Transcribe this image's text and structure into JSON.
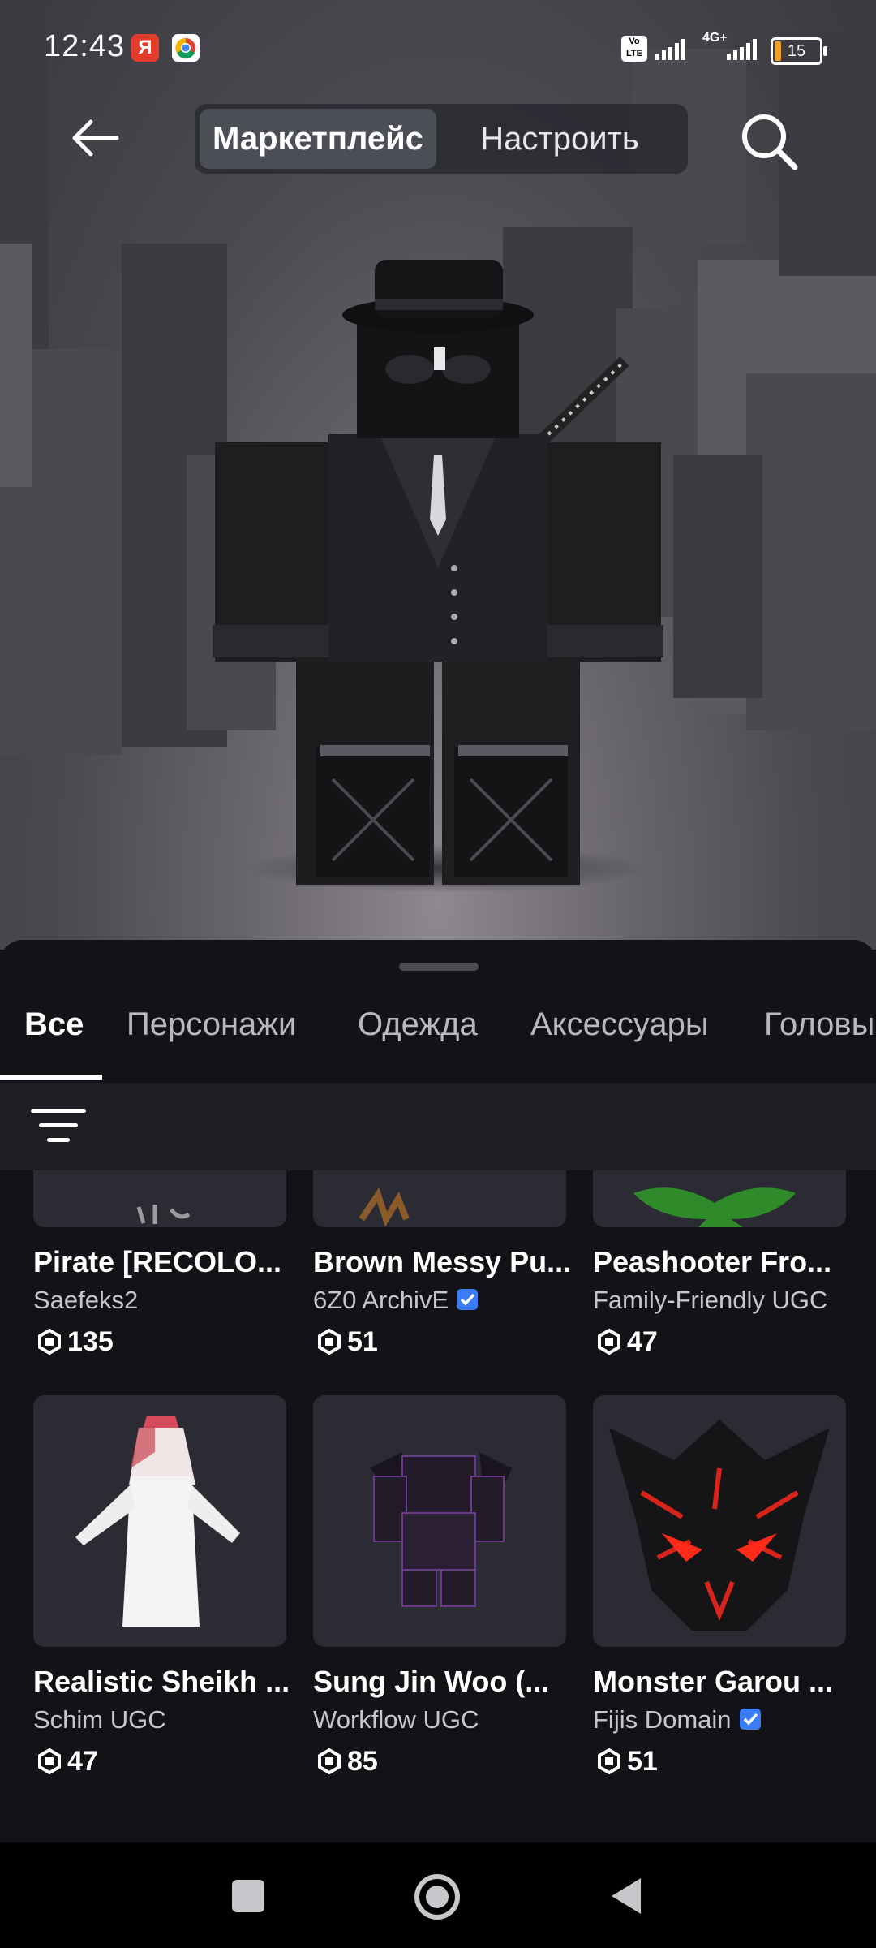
{
  "status_bar": {
    "time": "12:43",
    "yandex_badge": "Я",
    "volte": "Vo LTE",
    "network": "4G+",
    "battery": "15"
  },
  "nav": {
    "tabs": [
      {
        "label": "Маркетплейс",
        "active": true
      },
      {
        "label": "Настроить",
        "active": false
      }
    ]
  },
  "categories": [
    {
      "label": "Все",
      "active": true
    },
    {
      "label": "Персонажи",
      "active": false
    },
    {
      "label": "Одежда",
      "active": false
    },
    {
      "label": "Аксессуары",
      "active": false
    },
    {
      "label": "Головы",
      "active": false
    }
  ],
  "items": [
    {
      "title": "Pirate [RECOLO...",
      "creator": "Saefeks2",
      "verified": false,
      "price": "135"
    },
    {
      "title": "Brown Messy Pu...",
      "creator": "6Z0 ArchivE",
      "verified": true,
      "price": "51"
    },
    {
      "title": "Peashooter Fro...",
      "creator": "Family-Friendly UGC",
      "verified": false,
      "price": "47"
    },
    {
      "title": "Realistic Sheikh ...",
      "creator": "Schim UGC",
      "verified": false,
      "price": "47"
    },
    {
      "title": "Sung Jin Woo (...",
      "creator": "Workflow UGC",
      "verified": false,
      "price": "85"
    },
    {
      "title": "Monster Garou ...",
      "creator": "Fijis Domain",
      "verified": true,
      "price": "51"
    }
  ],
  "colors": {
    "sheet_bg": "#121316",
    "card_bg": "#2b2c33",
    "verified_blue": "#3a7bf7",
    "accent_red": "#e8321e"
  },
  "icons": {
    "back": "arrow-left-icon",
    "search": "search-icon",
    "filter": "filter-icon",
    "currency": "robux-icon",
    "verified": "verified-badge-icon"
  }
}
